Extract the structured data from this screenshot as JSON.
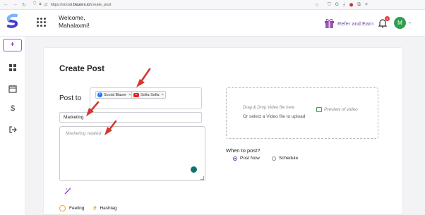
{
  "browser": {
    "url_prefix": "https://social.",
    "url_domain": "blazers.io",
    "url_path": "/create_post"
  },
  "header": {
    "welcome_line1": "Welcome,",
    "welcome_line2": "Mahalaxmi!",
    "refer_label": "Refer and Earn",
    "notification_count": "4",
    "avatar_initial": "M"
  },
  "sidebar": {
    "items": [
      {
        "icon": "plus-icon",
        "label": "+"
      },
      {
        "icon": "dashboard-icon"
      },
      {
        "icon": "calendar-icon"
      },
      {
        "icon": "dollar-icon",
        "label": "$"
      },
      {
        "icon": "logout-icon"
      }
    ]
  },
  "form": {
    "title": "Create Post",
    "post_to_label": "Post to",
    "accounts": [
      {
        "platform": "facebook",
        "name": "Social Blazer"
      },
      {
        "platform": "youtube",
        "name": "Sofia Sofia"
      }
    ],
    "topic_value": "Marketing",
    "body_placeholder": "Marketing related",
    "feeling_label": "Feeling",
    "hashtag_label": "Hashtag"
  },
  "media": {
    "drop_hint": "Drag & Drop Video file here",
    "select_hint": "Or select a Video file to upload",
    "preview_label": "Preview of video"
  },
  "schedule": {
    "question": "When to post?",
    "options": [
      {
        "label": "Post Now",
        "selected": true
      },
      {
        "label": "Schedule",
        "selected": false
      }
    ]
  },
  "colors": {
    "accent": "#7b3fb5",
    "annotation_arrow": "#d9352b",
    "avatar": "#2e9e4f"
  }
}
